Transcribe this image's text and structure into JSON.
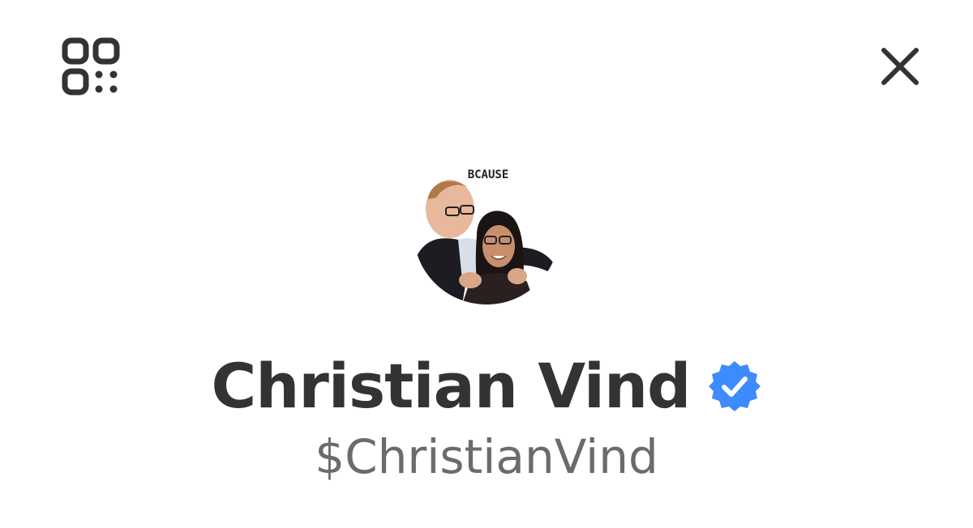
{
  "header": {
    "qr_icon": "qr-code-icon",
    "close_icon": "close-icon"
  },
  "profile": {
    "display_name": "Christian Vind",
    "cashtag": "$ChristianVind",
    "verified": true,
    "avatar_logo_text": "BCAUSE"
  },
  "colors": {
    "text_primary": "#333333",
    "text_secondary": "#6b6b6b",
    "verified_blue": "#3d8bfd",
    "background": "#ffffff"
  }
}
